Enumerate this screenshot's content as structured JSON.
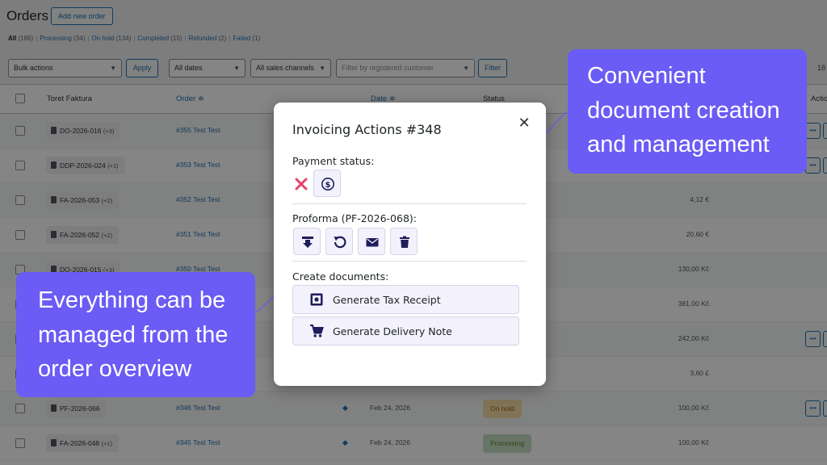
{
  "admin": {
    "page_title": "Orders",
    "add_new_label": "Add new order",
    "status_links": [
      {
        "label": "All",
        "count": "(186)",
        "current": true
      },
      {
        "label": "Processing",
        "count": "(34)"
      },
      {
        "label": "On hold",
        "count": "(134)"
      },
      {
        "label": "Completed",
        "count": "(15)"
      },
      {
        "label": "Refunded",
        "count": "(2)"
      },
      {
        "label": "Failed",
        "count": "(1)"
      }
    ],
    "filters": {
      "bulk_actions": "Bulk actions",
      "apply": "Apply",
      "dates": "All dates",
      "channels": "All sales channels",
      "customer_placeholder": "Filter by registered customer",
      "filter": "Filter",
      "page_count": "18"
    },
    "columns": {
      "faktura": "Toret Faktura",
      "order": "Order ≑",
      "date": "Date ≑",
      "status": "Status",
      "actions": "Actio"
    },
    "rows": [
      {
        "doc": "DO-2026-016",
        "extra": "(+3)",
        "order": "#355 Test Test",
        "date": "",
        "status": "",
        "total": "",
        "actions": true
      },
      {
        "doc": "DDP-2026-024",
        "extra": "(+1)",
        "order": "#353 Test Test",
        "date": "",
        "status": "",
        "total": "",
        "actions": true
      },
      {
        "doc": "FA-2026-053",
        "extra": "(+2)",
        "order": "#352 Test Test",
        "date": "",
        "status": "",
        "total": "4,12 €",
        "actions": false
      },
      {
        "doc": "FA-2026-052",
        "extra": "(+2)",
        "order": "#351 Test Test",
        "date": "",
        "status": "",
        "total": "20,60 €",
        "actions": false
      },
      {
        "doc": "DO-2026-015",
        "extra": "(+3)",
        "order": "#350 Test Test",
        "date": "",
        "status": "",
        "total": "130,00 Kč",
        "actions": false
      },
      {
        "doc": "",
        "extra": "",
        "order": "",
        "date": "",
        "status": "",
        "total": "381,00 Kč",
        "actions": false
      },
      {
        "doc": "",
        "extra": "",
        "order": "",
        "date": "",
        "status": "",
        "total": "242,00 Kč",
        "actions": true
      },
      {
        "doc": "",
        "extra": "",
        "order": "",
        "date": "",
        "status": "",
        "total": "3,60 £",
        "actions": false
      },
      {
        "doc": "PF-2026-066",
        "extra": "",
        "order": "#346 Test Test",
        "date": "Feb 24, 2026",
        "status": "On hold",
        "status_bg": "#f8dda7",
        "status_fg": "#94660c",
        "total": "100,00 Kč",
        "actions": true
      },
      {
        "doc": "FA-2026-048",
        "extra": "(+1)",
        "order": "#345 Test Test",
        "date": "Feb 24, 2026",
        "status": "Processing",
        "status_bg": "#c6e1c6",
        "status_fg": "#5b841b",
        "total": "100,00 Kč",
        "actions": false
      }
    ],
    "action_icon": "ellipsis-icon"
  },
  "modal": {
    "title": "Invoicing Actions #348",
    "close_icon": "close-icon",
    "payment_label": "Payment status:",
    "payment_icons": [
      "x-mark-icon",
      "dollar-circle-icon"
    ],
    "proforma_label": "Proforma (PF-2026-068):",
    "proforma_icons": [
      "download-icon",
      "regenerate-icon",
      "email-icon",
      "trash-icon"
    ],
    "create_label": "Create documents:",
    "documents": [
      {
        "label": "Generate Tax Receipt",
        "icon": "receipt-icon"
      },
      {
        "label": "Generate Delivery Note",
        "icon": "cart-icon"
      }
    ],
    "accent": "#e8416c",
    "icon_color": "#1f1d5c"
  },
  "callouts": {
    "top": [
      "Convenient",
      "document creation",
      "and management"
    ],
    "left": [
      "Everything can be",
      "managed from the",
      "order overview"
    ],
    "color": "#6a5cf5"
  }
}
